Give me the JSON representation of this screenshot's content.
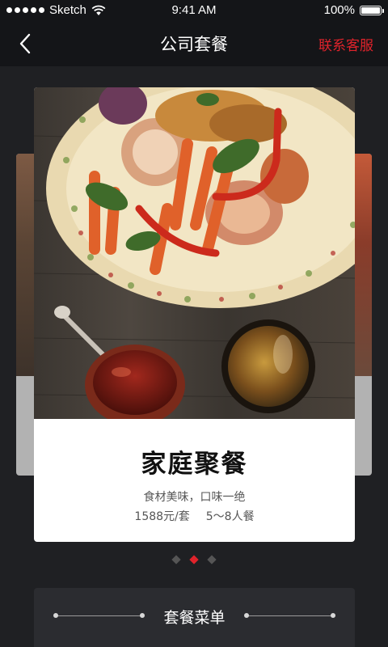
{
  "status_bar": {
    "carrier": "Sketch",
    "time": "9:41 AM",
    "battery": "100%"
  },
  "nav": {
    "title": "公司套餐",
    "contact_label": "联系客服"
  },
  "package": {
    "name": "家庭聚餐",
    "description": "食材美味，口味一绝",
    "price": "1588元/套",
    "serves": "5～8人餐"
  },
  "carousel": {
    "total": 3,
    "active_index": 1
  },
  "menu_section": {
    "title": "套餐菜单"
  },
  "colors": {
    "accent": "#e0232b",
    "background": "#1f2023",
    "bar": "#141518"
  }
}
